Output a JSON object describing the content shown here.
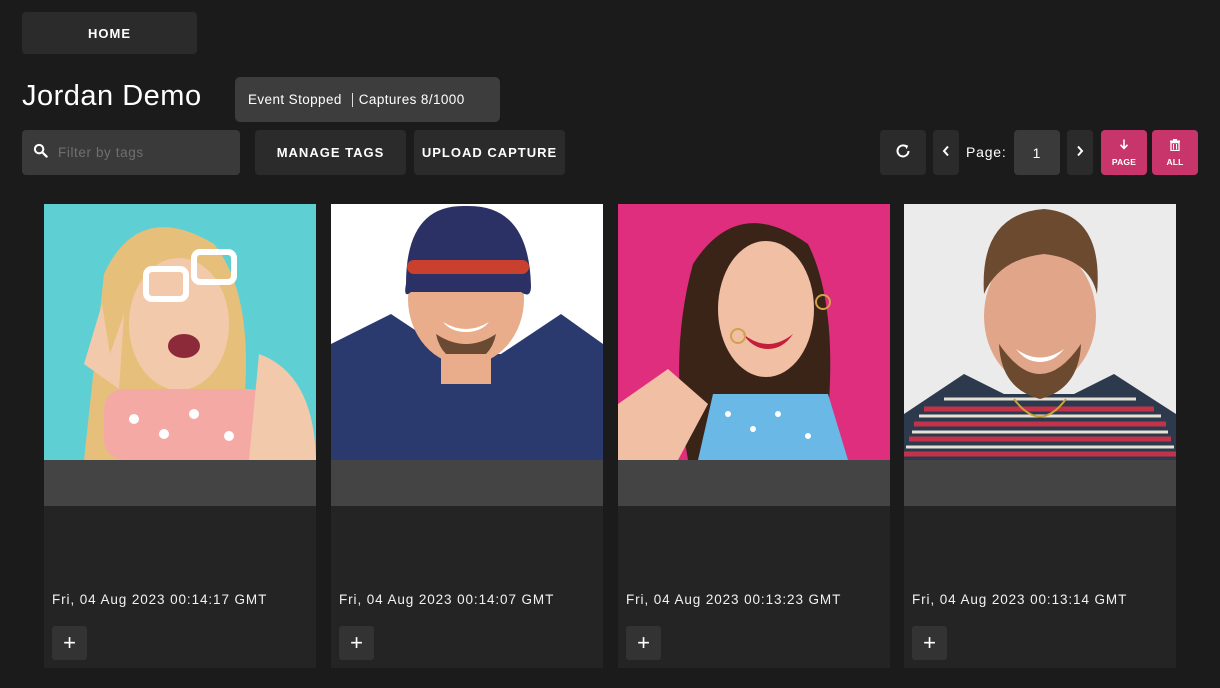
{
  "nav": {
    "home_label": "HOME"
  },
  "event": {
    "title": "Jordan Demo",
    "status": "Event Stopped",
    "captures": "Captures 8/1000"
  },
  "toolbar": {
    "search_placeholder": "Filter by tags",
    "manage_tags": "MANAGE TAGS",
    "upload_capture": "UPLOAD CAPTURE",
    "page_label": "Page:",
    "page_value": "1",
    "download_page": "PAGE",
    "download_all": "ALL",
    "icons": {
      "search": "search-icon",
      "refresh": "refresh-icon",
      "prev": "chevron-left-icon",
      "next": "chevron-right-icon",
      "download": "download-icon",
      "trash": "trash-icon"
    }
  },
  "colors": {
    "background": "#1b1b1b",
    "accent": "#c8356a",
    "card": "#242424",
    "tag_bar": "#444444"
  },
  "captures": [
    {
      "date": "Fri, 04 Aug 2023 00:14:17 GMT",
      "add_label": "+",
      "bg": "#5ecfd3"
    },
    {
      "date": "Fri, 04 Aug 2023 00:14:07 GMT",
      "add_label": "+",
      "bg": "#ffffff"
    },
    {
      "date": "Fri, 04 Aug 2023 00:13:23 GMT",
      "add_label": "+",
      "bg": "#e02e7e"
    },
    {
      "date": "Fri, 04 Aug 2023 00:13:14 GMT",
      "add_label": "+",
      "bg": "#ebebeb"
    }
  ]
}
